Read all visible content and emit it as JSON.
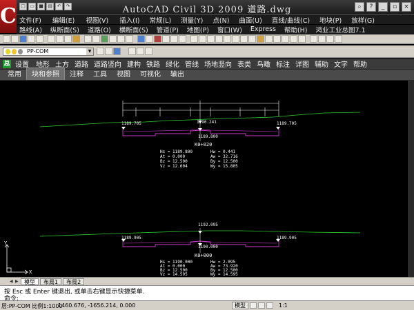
{
  "app": {
    "title": "AutoCAD Civil 3D 2009",
    "file": "道路.dwg"
  },
  "menu1": [
    "文件(F)",
    "编辑(E)",
    "视图(V)",
    "插入(I)",
    "常规(L)",
    "测量(Y)",
    "点(N)",
    "曲面(U)",
    "直线/曲线(C)",
    "地块(P)",
    "放样(G)"
  ],
  "menu2": [
    "路线(A)",
    "纵断面(S)",
    "道路(O)",
    "横断面(S)",
    "管道(P)",
    "地图(P)",
    "窗口(W)",
    "Express",
    "帮助(H)",
    "鸿业工业总图7.1"
  ],
  "layer_combo": "PP-COM",
  "civil_toolbar": [
    "设置",
    "地形",
    "土方",
    "道路",
    "道路竖向",
    "建构",
    "铁路",
    "绿化",
    "管线",
    "场地竖向",
    "表类",
    "鸟瞰",
    "标注",
    "详图",
    "辅助",
    "文字",
    "帮助"
  ],
  "ribbon_tabs": [
    "常用",
    "块和参照",
    "注释",
    "工具",
    "视图",
    "可视化",
    "输出"
  ],
  "ribbon_active": "块和参照",
  "section1": {
    "center_elev": "1190.241",
    "left_elev": "1189.705",
    "right_elev": "1189.705",
    "design_elev": "1189.800",
    "station": "K0+020",
    "left_stats": [
      "Hs = 1189.800",
      "At = 0.000",
      "Bz = 12.500",
      "Vz = 12.604"
    ],
    "right_stats": [
      "Hw = 0.441",
      "Aw = 32.716",
      "By = 12.500",
      "Wy = 15.805"
    ]
  },
  "section2": {
    "center_elev": "1192.095",
    "left_elev": "1189.905",
    "right_elev": "1189.905",
    "design_elev": "1190.000",
    "station": "K0+000",
    "left_stats": [
      "Hs = 1190.000",
      "At = 0.000",
      "Bz = 12.500",
      "Vz = 14.595"
    ],
    "right_stats": [
      "Hw = 2.095",
      "Aw = 73.920",
      "By = 12.500",
      "Wy = 14.595"
    ]
  },
  "ucs": {
    "x": "X",
    "y": "Y"
  },
  "layout_tabs": [
    "模型",
    "布局1",
    "布局2"
  ],
  "command": {
    "line1": "按 Esc 或 Enter 键退出, 或单击右键显示快捷菜单.",
    "line2": "命令:"
  },
  "status": {
    "layer": "层:PP-COM",
    "scale_text": "比例1:1000",
    "coords": "1460.676, -1656.214, 0.000",
    "model": "模型",
    "annotation_scale": "1:1"
  },
  "colors": {
    "ground_line": "#2bd12b",
    "design_line": "#d23ad2",
    "text": "#ffffff",
    "logo": "#c42020"
  }
}
